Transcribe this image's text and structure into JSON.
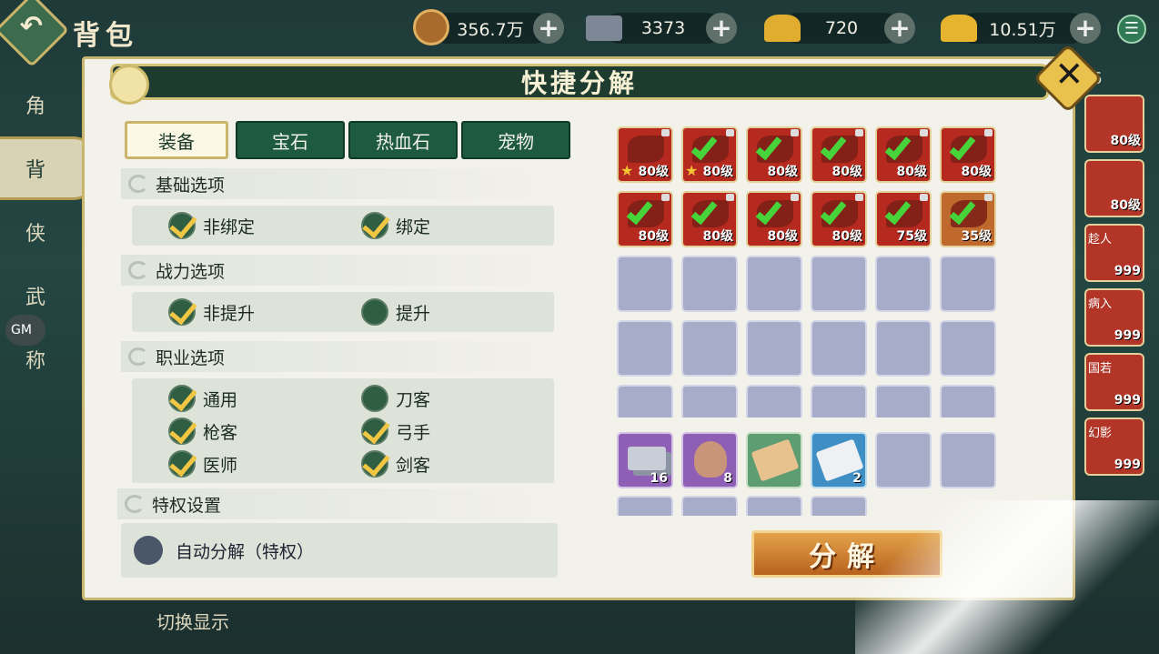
{
  "header": {
    "back_icon": "back-arrow-icon",
    "title": "背包",
    "resources": [
      {
        "value": "356.7万",
        "icon": "coin-icon"
      },
      {
        "value": "3373",
        "icon": "silver-ingot-icon"
      },
      {
        "value": "720",
        "icon": "gold-ingot-icon"
      },
      {
        "value": "10.51万",
        "icon": "gold-ingot-icon"
      }
    ],
    "menu_icon": "list-menu-icon"
  },
  "left_nav": {
    "items": [
      {
        "label": "角",
        "icon": "fist-icon"
      },
      {
        "label": "背",
        "icon": "bag-icon",
        "active": true
      },
      {
        "label": "侠",
        "icon": "fan-icon"
      },
      {
        "label": "武",
        "icon": "skill-icon"
      },
      {
        "label": "称",
        "icon": "lotus-icon"
      }
    ],
    "gm_label": "GM"
  },
  "background": {
    "bag_count": "6",
    "switch_display": "切换显示",
    "right_items": [
      {
        "name": "",
        "level": "80级"
      },
      {
        "name": "",
        "level": "80级"
      },
      {
        "name": "趁人",
        "level": "999"
      },
      {
        "name": "病入",
        "level": "999"
      },
      {
        "name": "国若",
        "level": "999"
      },
      {
        "name": "幻影",
        "level": "999"
      }
    ]
  },
  "dialog": {
    "title": "快捷分解",
    "close_icon": "close-x-icon",
    "tabs": [
      "装备",
      "宝石",
      "热血石",
      "宠物"
    ],
    "active_tab": 0,
    "sections": {
      "basic": {
        "title": "基础选项",
        "options": [
          {
            "label": "非绑定",
            "checked": true
          },
          {
            "label": "绑定",
            "checked": true
          }
        ]
      },
      "power": {
        "title": "战力选项",
        "options": [
          {
            "label": "非提升",
            "checked": true
          },
          {
            "label": "提升",
            "checked": false
          }
        ]
      },
      "job": {
        "title": "职业选项",
        "options": [
          {
            "label": "通用",
            "checked": true
          },
          {
            "label": "刀客",
            "checked": false
          },
          {
            "label": "枪客",
            "checked": true
          },
          {
            "label": "弓手",
            "checked": true
          },
          {
            "label": "医师",
            "checked": true
          },
          {
            "label": "剑客",
            "checked": true
          }
        ]
      }
    },
    "privilege": {
      "title": "特权设置",
      "auto_label": "自动分解（特权）",
      "auto_on": false
    },
    "equipment": [
      {
        "level": "80级",
        "star": "2",
        "checked": false,
        "color": "red"
      },
      {
        "level": "80级",
        "star": "2",
        "checked": true,
        "color": "red"
      },
      {
        "level": "80级",
        "star": "",
        "checked": true,
        "color": "red"
      },
      {
        "level": "80级",
        "star": "",
        "checked": true,
        "color": "red"
      },
      {
        "level": "80级",
        "star": "",
        "checked": true,
        "color": "red"
      },
      {
        "level": "80级",
        "star": "",
        "checked": true,
        "color": "red"
      },
      {
        "level": "80级",
        "star": "",
        "checked": true,
        "color": "red"
      },
      {
        "level": "80级",
        "star": "",
        "checked": true,
        "color": "red"
      },
      {
        "level": "80级",
        "star": "",
        "checked": true,
        "color": "red"
      },
      {
        "level": "80级",
        "star": "",
        "checked": true,
        "color": "red"
      },
      {
        "level": "75级",
        "star": "",
        "checked": true,
        "color": "red"
      },
      {
        "level": "35级",
        "star": "",
        "checked": true,
        "color": "orange"
      }
    ],
    "materials": [
      {
        "count": "16",
        "kind": "silver-bar",
        "icon": "iron-bar-icon"
      },
      {
        "count": "8",
        "kind": "shell",
        "icon": "shell-icon"
      },
      {
        "count": "",
        "kind": "paper",
        "icon": "scroll-icon"
      },
      {
        "count": "2",
        "kind": "paper-white",
        "icon": "scroll-white-icon"
      }
    ],
    "decompose_label": "分解"
  }
}
